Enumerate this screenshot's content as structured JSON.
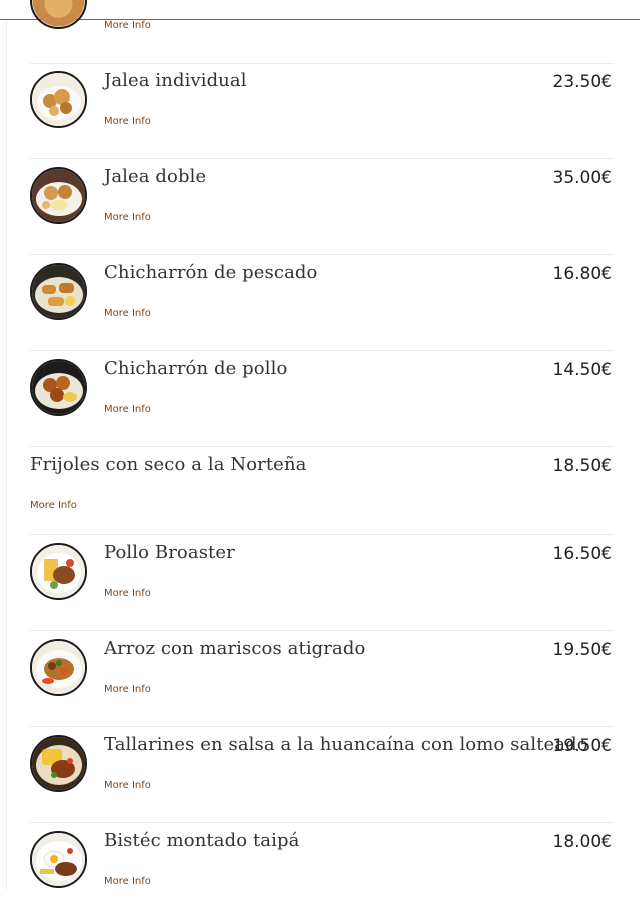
{
  "colors": {
    "accent_rule": "#b84a3a",
    "more_info": "#7a4a1a",
    "text": "#333333",
    "price": "#222222"
  },
  "menu": {
    "top_partial": {
      "more_label": "More Info"
    },
    "items": [
      {
        "name": "Jalea individual",
        "price": "23.50€",
        "more_label": "More Info",
        "image": "fried-seafood-plate"
      },
      {
        "name": "Jalea doble",
        "price": "35.00€",
        "more_label": "More Info",
        "image": "fried-seafood-plate-large"
      },
      {
        "name": "Chicharrón de pescado",
        "price": "16.80€",
        "more_label": "More Info",
        "image": "fried-fish-plate"
      },
      {
        "name": "Chicharrón de pollo",
        "price": "14.50€",
        "more_label": "More Info",
        "image": "fried-chicken-plate"
      },
      {
        "name": "Frijoles con seco a la Norteña",
        "price": "18.50€",
        "more_label": "More Info",
        "image": ""
      },
      {
        "name": "Pollo Broaster",
        "price": "16.50€",
        "more_label": "More Info",
        "image": "broaster-chicken-plate"
      },
      {
        "name": "Arroz con mariscos atigrado",
        "price": "19.50€",
        "more_label": "More Info",
        "image": "seafood-rice-plate"
      },
      {
        "name": "Tallarines en salsa a la huancaína con lomo salteado",
        "price": "19.50€",
        "more_label": "More Info",
        "image": "noodles-lomo-plate"
      },
      {
        "name": "Bistéc montado taipá",
        "price": "18.00€",
        "more_label": "More Info",
        "image": "steak-egg-plate"
      }
    ]
  }
}
